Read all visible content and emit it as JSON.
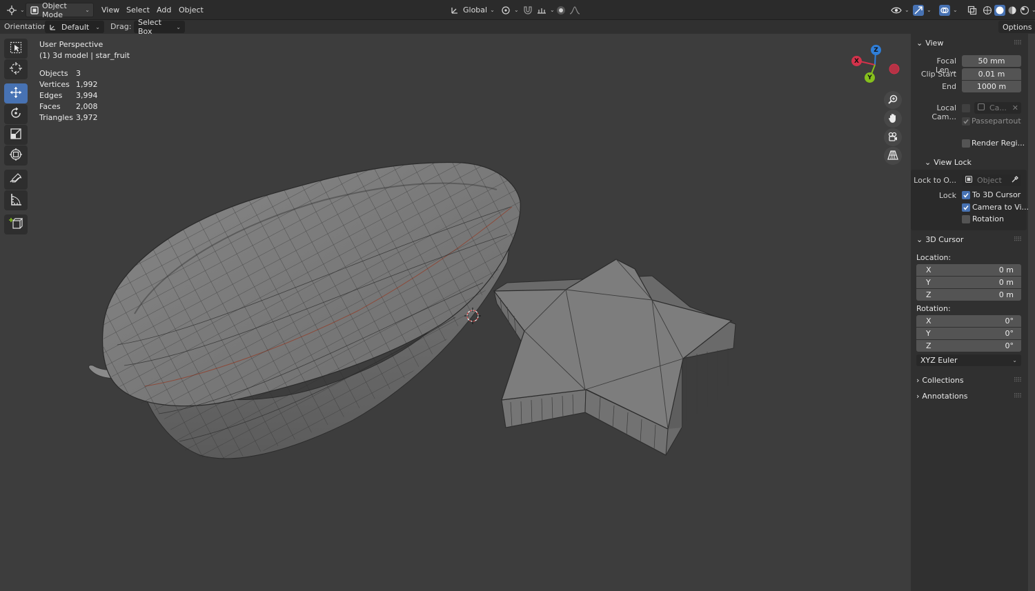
{
  "header": {
    "mode_label": "Object Mode",
    "menus": [
      "View",
      "Select",
      "Add",
      "Object"
    ],
    "transform_orientation": "Global"
  },
  "tool_settings": {
    "orientation_label": "Orientation:",
    "orientation_value": "Default",
    "drag_label": "Drag:",
    "drag_value": "Select Box",
    "options_label": "Options"
  },
  "viewport": {
    "view_name": "User Perspective",
    "object_info": "(1) 3d model | star_fruit",
    "stats": [
      {
        "label": "Objects",
        "value": "3"
      },
      {
        "label": "Vertices",
        "value": "1,992"
      },
      {
        "label": "Edges",
        "value": "3,994"
      },
      {
        "label": "Faces",
        "value": "2,008"
      },
      {
        "label": "Triangles",
        "value": "3,972"
      }
    ],
    "gizmo": {
      "x": "X",
      "y": "Y",
      "z": "Z"
    }
  },
  "sidebar": {
    "view": {
      "title": "View",
      "focal_label": "Focal Len...",
      "focal_value": "50 mm",
      "clip_start_label": "Clip Start",
      "clip_start_value": "0.01 m",
      "end_label": "End",
      "end_value": "1000 m",
      "local_cam_label": "Local Cam...",
      "local_cam_value": "Ca...",
      "passepartout_label": "Passepartout",
      "render_region_label": "Render Regi..."
    },
    "view_lock": {
      "title": "View Lock",
      "lock_to_label": "Lock to O...",
      "lock_to_placeholder": "Object",
      "lock_label": "Lock",
      "to_3d_cursor": "To 3D Cursor",
      "camera_to_view": "Camera to Vi...",
      "rotation": "Rotation"
    },
    "cursor": {
      "title": "3D Cursor",
      "location_label": "Location:",
      "location": [
        {
          "axis": "X",
          "value": "0 m"
        },
        {
          "axis": "Y",
          "value": "0 m"
        },
        {
          "axis": "Z",
          "value": "0 m"
        }
      ],
      "rotation_label": "Rotation:",
      "rotation": [
        {
          "axis": "X",
          "value": "0°"
        },
        {
          "axis": "Y",
          "value": "0°"
        },
        {
          "axis": "Z",
          "value": "0°"
        }
      ],
      "rotation_mode": "XYZ Euler"
    },
    "collections_title": "Collections",
    "annotations_title": "Annotations"
  },
  "colors": {
    "accent": "#4772b3",
    "viewport_bg": "#3d3d3d",
    "axis_x": "#d4324b",
    "axis_y": "#86c01d",
    "axis_z": "#2f7ed8"
  }
}
